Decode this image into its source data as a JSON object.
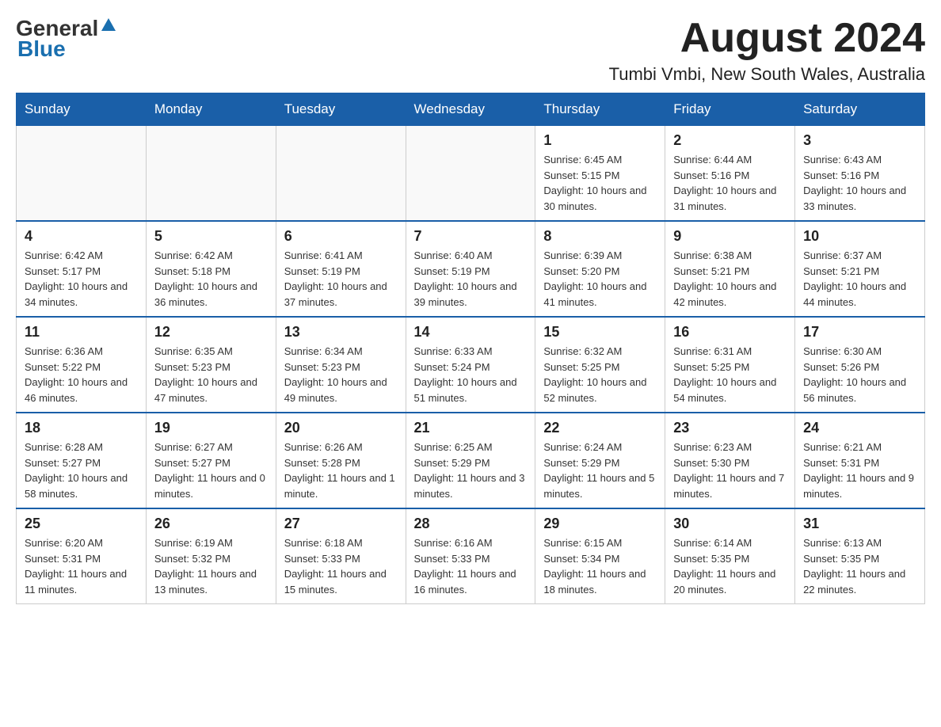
{
  "header": {
    "logo": {
      "text_dark": "General",
      "text_blue": "Blue"
    },
    "month_title": "August 2024",
    "location": "Tumbi Vmbi, New South Wales, Australia"
  },
  "days_of_week": [
    "Sunday",
    "Monday",
    "Tuesday",
    "Wednesday",
    "Thursday",
    "Friday",
    "Saturday"
  ],
  "weeks": [
    [
      {
        "day": "",
        "info": ""
      },
      {
        "day": "",
        "info": ""
      },
      {
        "day": "",
        "info": ""
      },
      {
        "day": "",
        "info": ""
      },
      {
        "day": "1",
        "info": "Sunrise: 6:45 AM\nSunset: 5:15 PM\nDaylight: 10 hours and 30 minutes."
      },
      {
        "day": "2",
        "info": "Sunrise: 6:44 AM\nSunset: 5:16 PM\nDaylight: 10 hours and 31 minutes."
      },
      {
        "day": "3",
        "info": "Sunrise: 6:43 AM\nSunset: 5:16 PM\nDaylight: 10 hours and 33 minutes."
      }
    ],
    [
      {
        "day": "4",
        "info": "Sunrise: 6:42 AM\nSunset: 5:17 PM\nDaylight: 10 hours and 34 minutes."
      },
      {
        "day": "5",
        "info": "Sunrise: 6:42 AM\nSunset: 5:18 PM\nDaylight: 10 hours and 36 minutes."
      },
      {
        "day": "6",
        "info": "Sunrise: 6:41 AM\nSunset: 5:19 PM\nDaylight: 10 hours and 37 minutes."
      },
      {
        "day": "7",
        "info": "Sunrise: 6:40 AM\nSunset: 5:19 PM\nDaylight: 10 hours and 39 minutes."
      },
      {
        "day": "8",
        "info": "Sunrise: 6:39 AM\nSunset: 5:20 PM\nDaylight: 10 hours and 41 minutes."
      },
      {
        "day": "9",
        "info": "Sunrise: 6:38 AM\nSunset: 5:21 PM\nDaylight: 10 hours and 42 minutes."
      },
      {
        "day": "10",
        "info": "Sunrise: 6:37 AM\nSunset: 5:21 PM\nDaylight: 10 hours and 44 minutes."
      }
    ],
    [
      {
        "day": "11",
        "info": "Sunrise: 6:36 AM\nSunset: 5:22 PM\nDaylight: 10 hours and 46 minutes."
      },
      {
        "day": "12",
        "info": "Sunrise: 6:35 AM\nSunset: 5:23 PM\nDaylight: 10 hours and 47 minutes."
      },
      {
        "day": "13",
        "info": "Sunrise: 6:34 AM\nSunset: 5:23 PM\nDaylight: 10 hours and 49 minutes."
      },
      {
        "day": "14",
        "info": "Sunrise: 6:33 AM\nSunset: 5:24 PM\nDaylight: 10 hours and 51 minutes."
      },
      {
        "day": "15",
        "info": "Sunrise: 6:32 AM\nSunset: 5:25 PM\nDaylight: 10 hours and 52 minutes."
      },
      {
        "day": "16",
        "info": "Sunrise: 6:31 AM\nSunset: 5:25 PM\nDaylight: 10 hours and 54 minutes."
      },
      {
        "day": "17",
        "info": "Sunrise: 6:30 AM\nSunset: 5:26 PM\nDaylight: 10 hours and 56 minutes."
      }
    ],
    [
      {
        "day": "18",
        "info": "Sunrise: 6:28 AM\nSunset: 5:27 PM\nDaylight: 10 hours and 58 minutes."
      },
      {
        "day": "19",
        "info": "Sunrise: 6:27 AM\nSunset: 5:27 PM\nDaylight: 11 hours and 0 minutes."
      },
      {
        "day": "20",
        "info": "Sunrise: 6:26 AM\nSunset: 5:28 PM\nDaylight: 11 hours and 1 minute."
      },
      {
        "day": "21",
        "info": "Sunrise: 6:25 AM\nSunset: 5:29 PM\nDaylight: 11 hours and 3 minutes."
      },
      {
        "day": "22",
        "info": "Sunrise: 6:24 AM\nSunset: 5:29 PM\nDaylight: 11 hours and 5 minutes."
      },
      {
        "day": "23",
        "info": "Sunrise: 6:23 AM\nSunset: 5:30 PM\nDaylight: 11 hours and 7 minutes."
      },
      {
        "day": "24",
        "info": "Sunrise: 6:21 AM\nSunset: 5:31 PM\nDaylight: 11 hours and 9 minutes."
      }
    ],
    [
      {
        "day": "25",
        "info": "Sunrise: 6:20 AM\nSunset: 5:31 PM\nDaylight: 11 hours and 11 minutes."
      },
      {
        "day": "26",
        "info": "Sunrise: 6:19 AM\nSunset: 5:32 PM\nDaylight: 11 hours and 13 minutes."
      },
      {
        "day": "27",
        "info": "Sunrise: 6:18 AM\nSunset: 5:33 PM\nDaylight: 11 hours and 15 minutes."
      },
      {
        "day": "28",
        "info": "Sunrise: 6:16 AM\nSunset: 5:33 PM\nDaylight: 11 hours and 16 minutes."
      },
      {
        "day": "29",
        "info": "Sunrise: 6:15 AM\nSunset: 5:34 PM\nDaylight: 11 hours and 18 minutes."
      },
      {
        "day": "30",
        "info": "Sunrise: 6:14 AM\nSunset: 5:35 PM\nDaylight: 11 hours and 20 minutes."
      },
      {
        "day": "31",
        "info": "Sunrise: 6:13 AM\nSunset: 5:35 PM\nDaylight: 11 hours and 22 minutes."
      }
    ]
  ]
}
